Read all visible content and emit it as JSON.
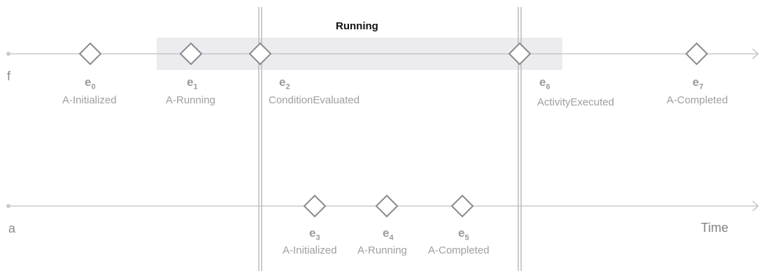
{
  "title": "Running",
  "axis_label": "Time",
  "lanes": [
    {
      "label": "f"
    },
    {
      "label": "a"
    }
  ],
  "events": [
    {
      "id": "e",
      "sub": "0",
      "name": "A-Initialized",
      "lane": "f"
    },
    {
      "id": "e",
      "sub": "1",
      "name": "A-Running",
      "lane": "f"
    },
    {
      "id": "e",
      "sub": "2",
      "name": "ConditionEvaluated",
      "lane": "f"
    },
    {
      "id": "e",
      "sub": "3",
      "name": "A-Initialized",
      "lane": "a"
    },
    {
      "id": "e",
      "sub": "4",
      "name": "A-Running",
      "lane": "a"
    },
    {
      "id": "e",
      "sub": "5",
      "name": "A-Completed",
      "lane": "a"
    },
    {
      "id": "e",
      "sub": "6",
      "name": "ActivityExecuted",
      "lane": "f"
    },
    {
      "id": "e",
      "sub": "7",
      "name": "A-Completed",
      "lane": "f"
    }
  ],
  "colors": {
    "line": "#c8c8c8",
    "diamond": "#8a8a8a",
    "highlight": "#ebebf0",
    "divider": "#bbbbbb"
  }
}
